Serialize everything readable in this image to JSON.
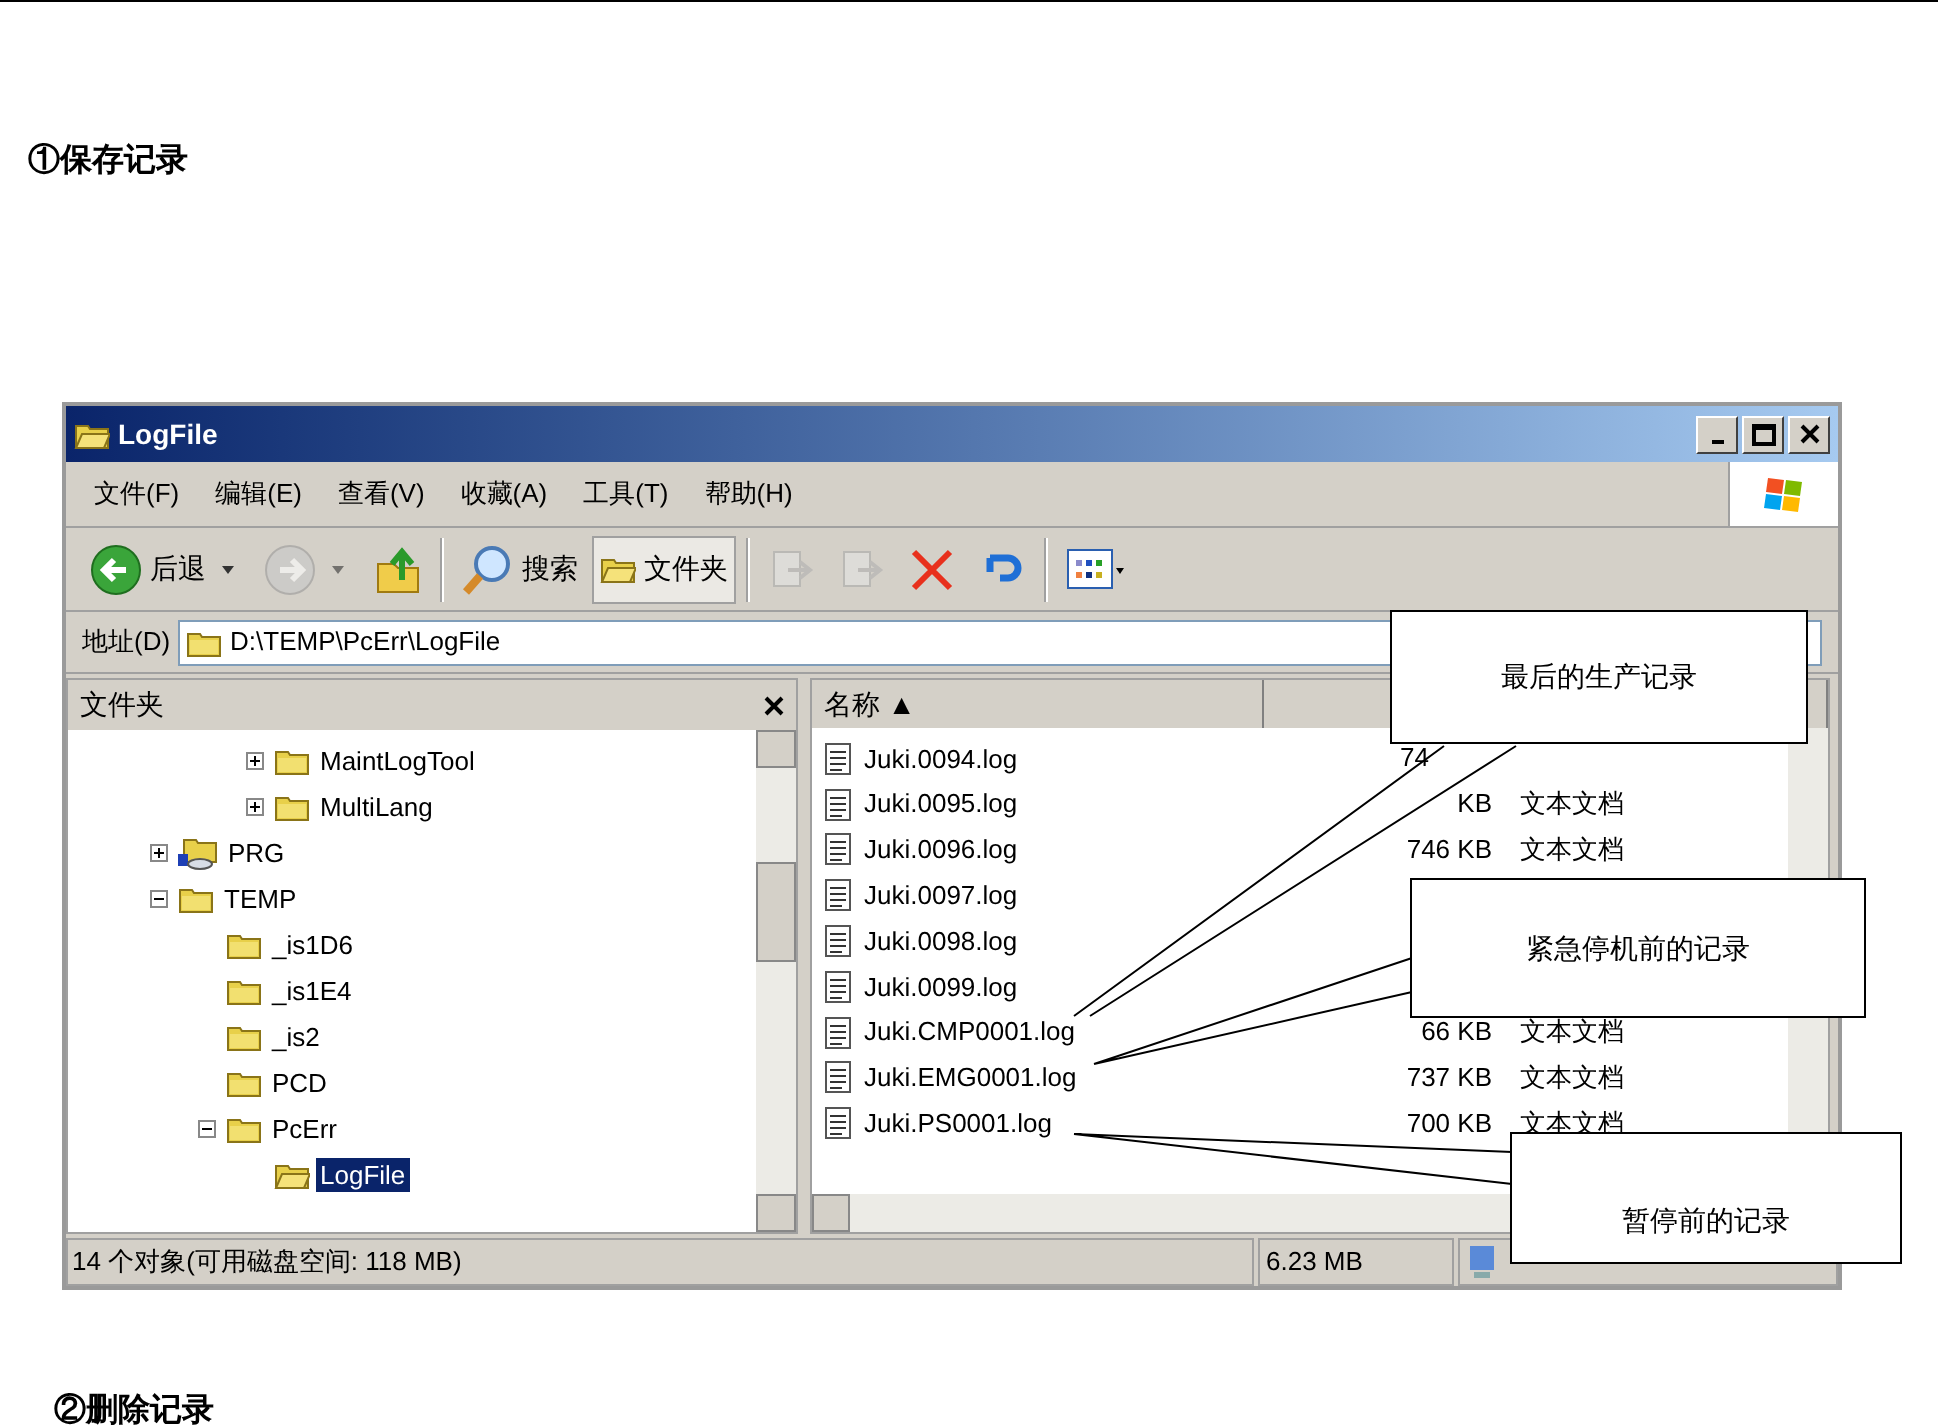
{
  "headings": [
    "①保存记录",
    "②删除记录"
  ],
  "window": {
    "title": "LogFile",
    "menu": [
      "文件(F)",
      "编辑(E)",
      "查看(V)",
      "收藏(A)",
      "工具(T)",
      "帮助(H)"
    ],
    "toolbar": [
      {
        "kind": "back",
        "label": "后退",
        "pressed": false,
        "disabled": false
      },
      {
        "kind": "forward",
        "pressed": false,
        "disabled": true
      },
      {
        "kind": "up",
        "pressed": false,
        "disabled": false
      },
      {
        "kind": "separator"
      },
      {
        "kind": "search",
        "label": "搜索",
        "pressed": false,
        "disabled": false
      },
      {
        "kind": "folders",
        "label": "文件夹",
        "pressed": true,
        "disabled": false
      },
      {
        "kind": "separator"
      },
      {
        "kind": "move",
        "pressed": false,
        "disabled": true
      },
      {
        "kind": "copy",
        "pressed": false,
        "disabled": true
      },
      {
        "kind": "delete",
        "pressed": false,
        "disabled": false
      },
      {
        "kind": "undo",
        "pressed": false,
        "disabled": false
      },
      {
        "kind": "separator"
      },
      {
        "kind": "views",
        "pressed": false,
        "disabled": false
      }
    ],
    "address": {
      "label": "地址(D)",
      "value": "D:\\TEMP\\PcErr\\LogFile"
    },
    "folders_pane": {
      "title": "文件夹",
      "tree": [
        {
          "children": [
            {
              "children": [
                {
                  "label": "MaintLogTool",
                  "kind": "collapsed",
                  "selected": false
                },
                {
                  "label": "MultiLang",
                  "kind": "collapsed",
                  "selected": false
                }
              ]
            }
          ]
        },
        {
          "label": "PRG",
          "kind": "collapsed",
          "selected": false
        },
        {
          "label": "TEMP",
          "kind": "expanded",
          "selected": false,
          "children": [
            {
              "label": "_is1D6",
              "kind": "leaf",
              "selected": false
            },
            {
              "label": "_is1E4",
              "kind": "leaf",
              "selected": false
            },
            {
              "label": "_is2",
              "kind": "leaf",
              "selected": false
            },
            {
              "label": "PCD",
              "kind": "leaf",
              "selected": false
            },
            {
              "label": "PcErr",
              "kind": "expanded",
              "selected": false,
              "children": [
                {
                  "label": "LogFile",
                  "kind": "leaf",
                  "selected": true
                }
              ]
            }
          ]
        }
      ]
    },
    "files": {
      "columns": [
        "名称 ▲"
      ],
      "rows": [
        {
          "name": "Juki.0094.log",
          "size": "74"
        },
        {
          "name": "Juki.0095.log",
          "size": "KB",
          "type": "文本文档"
        },
        {
          "name": "Juki.0096.log",
          "size": "746 KB",
          "type": "文本文档"
        },
        {
          "name": "Juki.0097.log"
        },
        {
          "name": "Juki.0098.log"
        },
        {
          "name": "Juki.0099.log"
        },
        {
          "name": "Juki.CMP0001.log",
          "size": "66 KB",
          "type": "文本文档"
        },
        {
          "name": "Juki.EMG0001.log",
          "size": "737 KB",
          "type": "文本文档"
        },
        {
          "name": "Juki.PS0001.log",
          "size": "700 KB",
          "type": "文本文档"
        }
      ]
    },
    "status_bar": [
      "14 个对象(可用磁盘空间: 118 MB)",
      "6.23 MB"
    ]
  },
  "callouts": [
    "最后的生产记录",
    "紧急停机前的记录",
    "暂停前的记录"
  ]
}
